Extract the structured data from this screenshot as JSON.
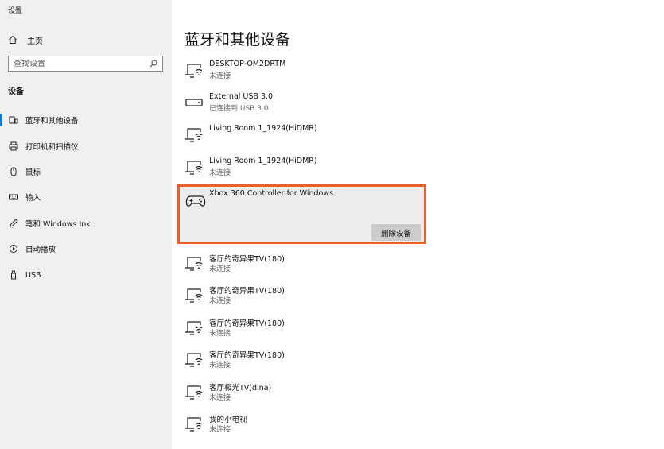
{
  "app": {
    "title": "设置"
  },
  "sidebar": {
    "home_label": "主页",
    "search_placeholder": "查找设置",
    "section_label": "设备",
    "items": [
      {
        "label": "蓝牙和其他设备",
        "icon": "bluetooth-devices-icon",
        "active": true
      },
      {
        "label": "打印机和扫描仪",
        "icon": "printer-icon"
      },
      {
        "label": "鼠标",
        "icon": "mouse-icon"
      },
      {
        "label": "输入",
        "icon": "keyboard-icon"
      },
      {
        "label": "笔和 Windows Ink",
        "icon": "pen-icon"
      },
      {
        "label": "自动播放",
        "icon": "autoplay-icon"
      },
      {
        "label": "USB",
        "icon": "usb-icon"
      }
    ]
  },
  "main": {
    "title": "蓝牙和其他设备",
    "devices": [
      {
        "name": "DESKTOP-OM2DRTM",
        "status": "未连接",
        "icon": "wireless-display-icon"
      },
      {
        "name": "External USB 3.0",
        "status": "已连接到 USB 3.0",
        "icon": "storage-drive-icon"
      },
      {
        "name": "Living Room 1_1924(HiDMR)",
        "status": "",
        "icon": "wireless-display-icon"
      },
      {
        "name": "Living Room 1_1924(HiDMR)",
        "status": "未连接",
        "icon": "wireless-display-icon"
      },
      {
        "name": "Xbox 360 Controller for Windows",
        "status": "",
        "icon": "gamepad-icon",
        "selected": true,
        "action_label": "删除设备"
      },
      {
        "name": "客厅的奇异果TV(180)",
        "status": "未连接",
        "icon": "wireless-display-icon"
      },
      {
        "name": "客厅的奇异果TV(180)",
        "status": "未连接",
        "icon": "wireless-display-icon"
      },
      {
        "name": "客厅的奇异果TV(180)",
        "status": "未连接",
        "icon": "wireless-display-icon"
      },
      {
        "name": "客厅的奇异果TV(180)",
        "status": "未连接",
        "icon": "wireless-display-icon"
      },
      {
        "name": "客厅极光TV(dlna)",
        "status": "未连接",
        "icon": "wireless-display-icon"
      },
      {
        "name": "我的小电视",
        "status": "未连接",
        "icon": "wireless-display-icon"
      }
    ]
  },
  "colors": {
    "accent": "#0078d7",
    "highlight_border": "#e8612c",
    "sidebar_bg": "#f0f0f0"
  }
}
